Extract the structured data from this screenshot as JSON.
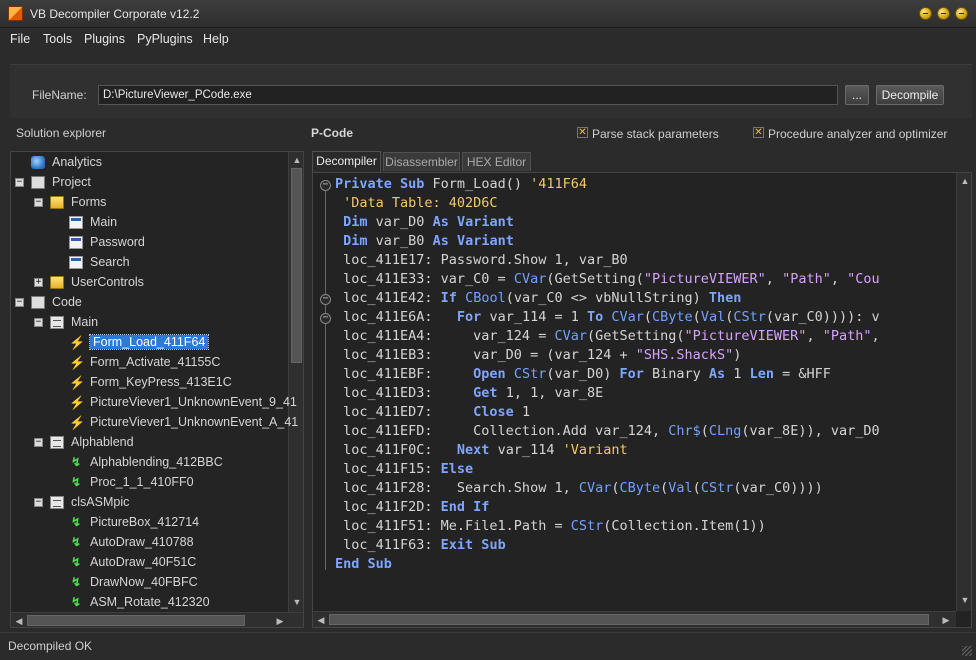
{
  "window": {
    "title": "VB Decompiler Corporate v12.2"
  },
  "menu": [
    "File",
    "Tools",
    "Plugins",
    "PyPlugins",
    "Help"
  ],
  "file": {
    "label": "FileName:",
    "value": "D:\\PictureViewer_PCode.exe",
    "browse_label": "...",
    "decompile_label": "Decompile"
  },
  "explorer": {
    "title": "Solution explorer",
    "items": [
      {
        "label": "Analytics",
        "depth": 1,
        "icon": "analytics-icon",
        "expander": ""
      },
      {
        "label": "Project",
        "depth": 1,
        "icon": "project-icon",
        "expander": "−"
      },
      {
        "label": "Forms",
        "depth": 2,
        "icon": "folder-icon",
        "expander": "−"
      },
      {
        "label": "Main",
        "depth": 3,
        "icon": "form-icon",
        "expander": ""
      },
      {
        "label": "Password",
        "depth": 3,
        "icon": "form-icon",
        "expander": ""
      },
      {
        "label": "Search",
        "depth": 3,
        "icon": "form-icon",
        "expander": ""
      },
      {
        "label": "UserControls",
        "depth": 2,
        "icon": "folder-icon",
        "expander": "+"
      },
      {
        "label": "Code",
        "depth": 1,
        "icon": "code-icon",
        "expander": "−"
      },
      {
        "label": "Main",
        "depth": 2,
        "icon": "module-icon",
        "expander": "−"
      },
      {
        "label": "Form_Load_411F64",
        "depth": 3,
        "icon": "event-icon",
        "expander": "",
        "selected": true
      },
      {
        "label": "Form_Activate_41155C",
        "depth": 3,
        "icon": "event-icon",
        "expander": ""
      },
      {
        "label": "Form_KeyPress_413E1C",
        "depth": 3,
        "icon": "event-icon",
        "expander": ""
      },
      {
        "label": "PictureViever1_UnknownEvent_9_41",
        "depth": 3,
        "icon": "event-icon",
        "expander": ""
      },
      {
        "label": "PictureViever1_UnknownEvent_A_41",
        "depth": 3,
        "icon": "event-icon",
        "expander": ""
      },
      {
        "label": "Alphablend",
        "depth": 2,
        "icon": "module-icon",
        "expander": "−"
      },
      {
        "label": "Alphablending_412BBC",
        "depth": 3,
        "icon": "procedure-icon",
        "expander": ""
      },
      {
        "label": "Proc_1_1_410FF0",
        "depth": 3,
        "icon": "procedure-icon",
        "expander": ""
      },
      {
        "label": "clsASMpic",
        "depth": 2,
        "icon": "module-icon",
        "expander": "−"
      },
      {
        "label": "PictureBox_412714",
        "depth": 3,
        "icon": "procedure-icon",
        "expander": ""
      },
      {
        "label": "AutoDraw_410788",
        "depth": 3,
        "icon": "procedure-icon",
        "expander": ""
      },
      {
        "label": "AutoDraw_40F51C",
        "depth": 3,
        "icon": "procedure-icon",
        "expander": ""
      },
      {
        "label": "DrawNow_40FBFC",
        "depth": 3,
        "icon": "procedure-icon",
        "expander": ""
      },
      {
        "label": "ASM_Rotate_412320",
        "depth": 3,
        "icon": "procedure-icon",
        "expander": ""
      }
    ]
  },
  "pcode": {
    "title": "P-Code",
    "options": [
      {
        "label": "Parse stack parameters",
        "checked": true
      },
      {
        "label": "Procedure analyzer and optimizer",
        "checked": true
      }
    ]
  },
  "tabs": [
    "Decompiler",
    "Disassembler",
    "HEX Editor"
  ],
  "active_tab": "Decompiler",
  "code": [
    [
      [
        "kw",
        "Private Sub "
      ],
      [
        "pl",
        "Form_Load() "
      ],
      [
        "cm",
        "'411F64"
      ]
    ],
    [
      [
        "cm",
        " 'Data Table: 402D6C"
      ]
    ],
    [
      [
        "pl",
        " "
      ],
      [
        "kw",
        "Dim "
      ],
      [
        "pl",
        "var_D0 "
      ],
      [
        "kw",
        "As Variant"
      ]
    ],
    [
      [
        "pl",
        " "
      ],
      [
        "kw",
        "Dim "
      ],
      [
        "pl",
        "var_B0 "
      ],
      [
        "kw",
        "As Variant"
      ]
    ],
    [
      [
        "pl",
        " loc_411E17: Password.Show 1, var_B0"
      ]
    ],
    [
      [
        "pl",
        " loc_411E33: var_C0 = "
      ],
      [
        "fn",
        "CVar"
      ],
      [
        "pl",
        "(GetSetting("
      ],
      [
        "st",
        "\"PictureVIEWER\""
      ],
      [
        "pl",
        ", "
      ],
      [
        "st",
        "\"Path\""
      ],
      [
        "pl",
        ", "
      ],
      [
        "st",
        "\"Cou"
      ]
    ],
    [
      [
        "pl",
        " loc_411E42: "
      ],
      [
        "kw",
        "If "
      ],
      [
        "fn",
        "CBool"
      ],
      [
        "pl",
        "(var_C0 <> vbNullString) "
      ],
      [
        "kw",
        "Then"
      ]
    ],
    [
      [
        "pl",
        " loc_411E6A:   "
      ],
      [
        "kw",
        "For "
      ],
      [
        "pl",
        "var_114 = 1 "
      ],
      [
        "kw",
        "To "
      ],
      [
        "fn",
        "CVar"
      ],
      [
        "pl",
        "("
      ],
      [
        "fn",
        "CByte"
      ],
      [
        "pl",
        "("
      ],
      [
        "fn",
        "Val"
      ],
      [
        "pl",
        "("
      ],
      [
        "fn",
        "CStr"
      ],
      [
        "pl",
        "(var_C0)))): v"
      ]
    ],
    [
      [
        "pl",
        " loc_411EA4:     var_124 = "
      ],
      [
        "fn",
        "CVar"
      ],
      [
        "pl",
        "(GetSetting("
      ],
      [
        "st",
        "\"PictureVIEWER\""
      ],
      [
        "pl",
        ", "
      ],
      [
        "st",
        "\"Path\""
      ],
      [
        "pl",
        ","
      ]
    ],
    [
      [
        "pl",
        " loc_411EB3:     var_D0 = (var_124 + "
      ],
      [
        "st",
        "\"SHS.ShackS\""
      ],
      [
        "pl",
        ")"
      ]
    ],
    [
      [
        "pl",
        " loc_411EBF:     "
      ],
      [
        "kw",
        "Open "
      ],
      [
        "fn",
        "CStr"
      ],
      [
        "pl",
        "(var_D0) "
      ],
      [
        "kw",
        "For "
      ],
      [
        "pl",
        "Binary "
      ],
      [
        "kw",
        "As "
      ],
      [
        "pl",
        "1 "
      ],
      [
        "kw",
        "Len "
      ],
      [
        "pl",
        "= &HFF"
      ]
    ],
    [
      [
        "pl",
        " loc_411ED3:     "
      ],
      [
        "kw",
        "Get "
      ],
      [
        "pl",
        "1, 1, var_8E"
      ]
    ],
    [
      [
        "pl",
        " loc_411ED7:     "
      ],
      [
        "kw",
        "Close "
      ],
      [
        "pl",
        "1"
      ]
    ],
    [
      [
        "pl",
        " loc_411EFD:     Collection.Add var_124, "
      ],
      [
        "fn",
        "Chr$"
      ],
      [
        "pl",
        "("
      ],
      [
        "fn",
        "CLng"
      ],
      [
        "pl",
        "(var_8E)), var_D0"
      ]
    ],
    [
      [
        "pl",
        " loc_411F0C:   "
      ],
      [
        "kw",
        "Next "
      ],
      [
        "pl",
        "var_114 "
      ],
      [
        "cm",
        "'Variant"
      ]
    ],
    [
      [
        "pl",
        " loc_411F15: "
      ],
      [
        "kw",
        "Else"
      ]
    ],
    [
      [
        "pl",
        " loc_411F28:   Search.Show 1, "
      ],
      [
        "fn",
        "CVar"
      ],
      [
        "pl",
        "("
      ],
      [
        "fn",
        "CByte"
      ],
      [
        "pl",
        "("
      ],
      [
        "fn",
        "Val"
      ],
      [
        "pl",
        "("
      ],
      [
        "fn",
        "CStr"
      ],
      [
        "pl",
        "(var_C0))))"
      ]
    ],
    [
      [
        "pl",
        " loc_411F2D: "
      ],
      [
        "kw",
        "End If"
      ]
    ],
    [
      [
        "pl",
        " loc_411F51: Me.File1.Path = "
      ],
      [
        "fn",
        "CStr"
      ],
      [
        "pl",
        "(Collection.Item(1))"
      ]
    ],
    [
      [
        "pl",
        " loc_411F63: "
      ],
      [
        "kw",
        "Exit Sub"
      ]
    ],
    [
      [
        "kw",
        "End Sub"
      ]
    ]
  ],
  "status": "Decompiled OK"
}
